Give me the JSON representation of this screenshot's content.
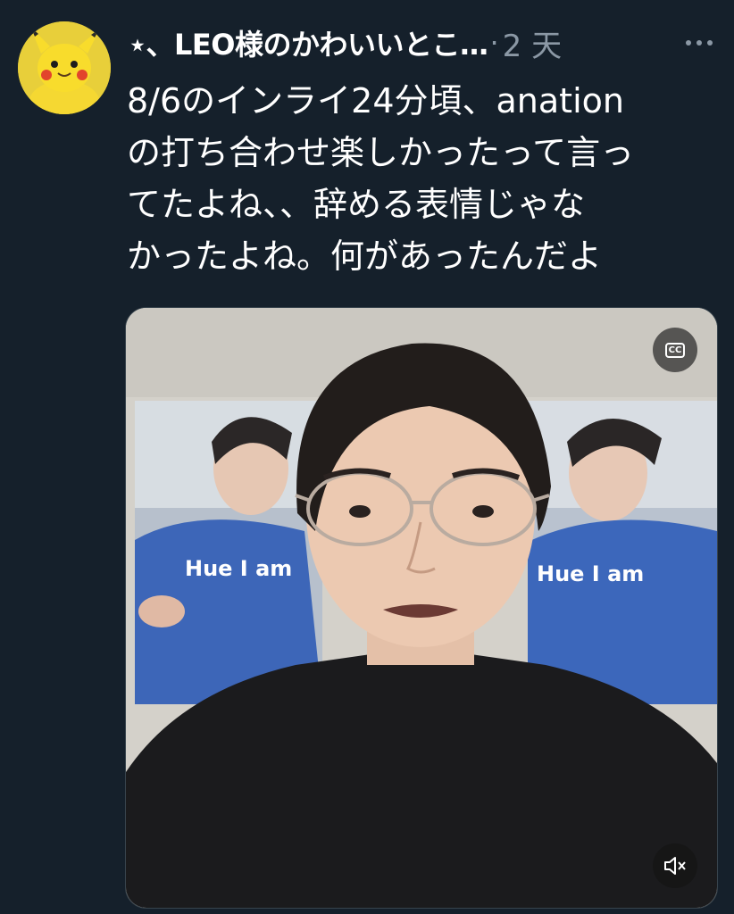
{
  "tweet": {
    "author_name": "⋆、LEO様のかわいいとこ…",
    "separator": "·",
    "time": "2 天",
    "text": "8/6のインライ24分頃、anation\nの打ち合わせ楽しかったって言っ\nてたよね、、辞める表情じゃな\nかったよね。何があったんだよ"
  },
  "media": {
    "type": "video",
    "poster_text_left": "Hue I am",
    "poster_text_right": "Hue I am",
    "cc_label": "CC"
  },
  "icons": {
    "more": "more-horizontal-icon",
    "captions": "closed-captions-icon",
    "mute": "volume-muted-icon"
  },
  "colors": {
    "background": "#15202b",
    "text_primary": "#ffffff",
    "text_secondary": "#8b98a5"
  }
}
